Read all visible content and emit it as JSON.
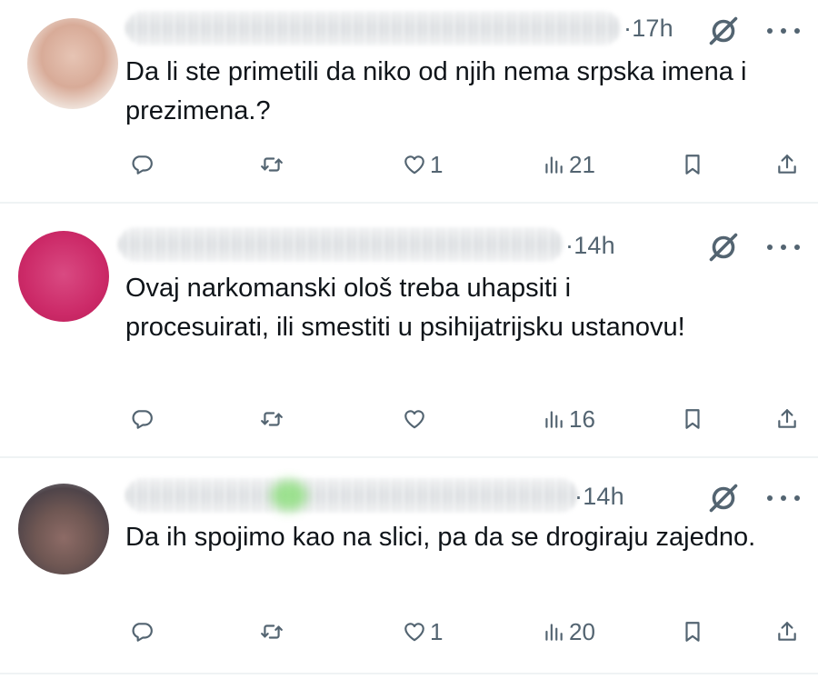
{
  "tweets": [
    {
      "time": "17h",
      "text": "Da li ste primetili da niko od njih nema srpska imena i prezimena.?",
      "replies": "",
      "reposts": "",
      "likes": "1",
      "views": "21"
    },
    {
      "time": "14h",
      "text": "Ovaj narkomanski ološ treba uhapsiti i procesuirati, ili smestiti u psihijatrijsku ustanovu!",
      "replies": "",
      "reposts": "",
      "likes": "",
      "views": "16"
    },
    {
      "time": "14h",
      "text": "Da ih spojimo kao na slici, pa da se drogiraju zajedno.",
      "replies": "",
      "reposts": "",
      "likes": "1",
      "views": "20"
    }
  ],
  "icons": {
    "reply": "reply-icon",
    "repost": "repost-icon",
    "like": "heart-icon",
    "views": "views-icon",
    "bookmark": "bookmark-icon",
    "share": "share-icon",
    "grok": "grok-icon",
    "more": "more-icon"
  },
  "colors": {
    "text": "#0f1419",
    "secondary": "#536471",
    "divider": "#eff3f4"
  }
}
